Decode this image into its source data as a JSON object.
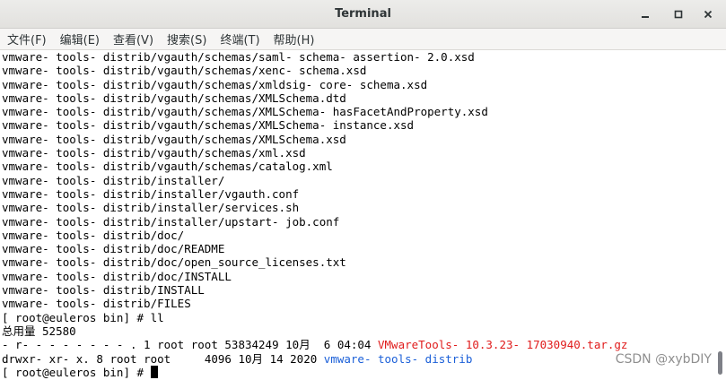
{
  "window": {
    "title": "Terminal",
    "controls": {
      "minimize_icon": "minimize-icon",
      "maximize_icon": "maximize-icon",
      "close_icon": "close-icon"
    }
  },
  "menubar": {
    "items": [
      {
        "label": "文件(F)"
      },
      {
        "label": "编辑(E)"
      },
      {
        "label": "查看(V)"
      },
      {
        "label": "搜索(S)"
      },
      {
        "label": "终端(T)"
      },
      {
        "label": "帮助(H)"
      }
    ]
  },
  "terminal": {
    "lines": [
      "vmware- tools- distrib/vgauth/schemas/saml- schema- assertion- 2.0.xsd",
      "vmware- tools- distrib/vgauth/schemas/xenc- schema.xsd",
      "vmware- tools- distrib/vgauth/schemas/xmldsig- core- schema.xsd",
      "vmware- tools- distrib/vgauth/schemas/XMLSchema.dtd",
      "vmware- tools- distrib/vgauth/schemas/XMLSchema- hasFacetAndProperty.xsd",
      "vmware- tools- distrib/vgauth/schemas/XMLSchema- instance.xsd",
      "vmware- tools- distrib/vgauth/schemas/XMLSchema.xsd",
      "vmware- tools- distrib/vgauth/schemas/xml.xsd",
      "vmware- tools- distrib/vgauth/schemas/catalog.xml",
      "vmware- tools- distrib/installer/",
      "vmware- tools- distrib/installer/vgauth.conf",
      "vmware- tools- distrib/installer/services.sh",
      "vmware- tools- distrib/installer/upstart- job.conf",
      "vmware- tools- distrib/doc/",
      "vmware- tools- distrib/doc/README",
      "vmware- tools- distrib/doc/open_source_licenses.txt",
      "vmware- tools- distrib/doc/INSTALL",
      "vmware- tools- distrib/INSTALL",
      "vmware- tools- distrib/FILES",
      "[ root@euleros bin] # ll",
      "总用量 52580"
    ],
    "listing": [
      {
        "perms": "- r- - - - - - - - .",
        "links": "1",
        "owner": "root",
        "group": "root",
        "size": "53834249",
        "month": "10月",
        "day": " 6",
        "time": "04:04",
        "name": "VMwareTools- 10.3.23- 17030940.tar.gz",
        "name_color": "#e01b1b"
      },
      {
        "perms": "drwxr- xr- x.",
        "links": "8",
        "owner": "root",
        "group": "root",
        "size": "4096",
        "month": "10月",
        "day": "14",
        "time": "2020",
        "name": "vmware- tools- distrib",
        "name_color": "#1a5fd8"
      }
    ],
    "prompt": "[ root@euleros bin] # "
  },
  "watermark": "CSDN @xybDIY"
}
